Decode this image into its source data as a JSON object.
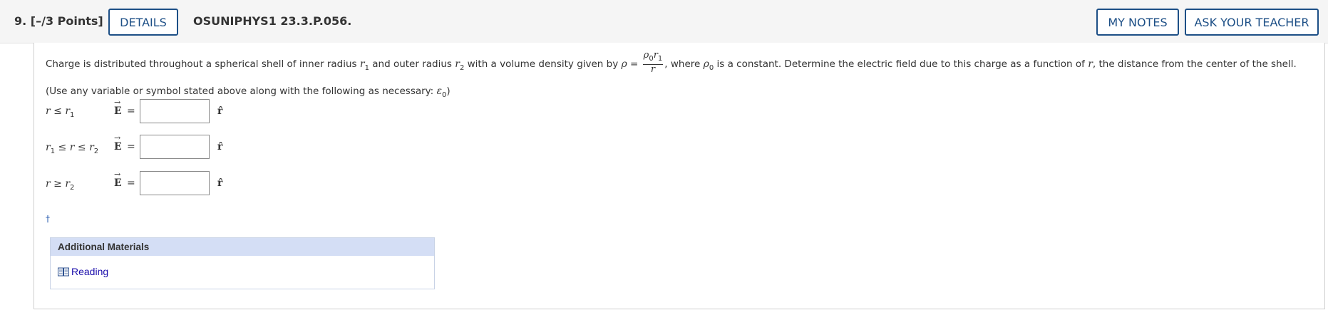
{
  "header": {
    "question_number": "9.",
    "points": "[–/3 Points]",
    "details_label": "DETAILS",
    "question_id": "OSUNIPHYS1 23.3.P.056.",
    "my_notes_label": "MY NOTES",
    "ask_teacher_label": "ASK YOUR TEACHER"
  },
  "prompt": {
    "t1": "Charge is distributed throughout a spherical shell of inner radius ",
    "r": "r",
    "one": "1",
    "two": "2",
    "zero": "0",
    "t2": " and outer radius ",
    "t3": " with a volume density given by ",
    "rho": "ρ",
    "equals": " = ",
    "t4": ", where ",
    "t5": " is a constant. Determine the electric field due to this charge as a function of ",
    "t6": ", the distance from the center of the shell. (Use any variable or symbol stated above along with the following as necessary: ",
    "epsilon": "ε",
    "t7": ")"
  },
  "answers": {
    "rows": [
      {
        "cond_a": "r",
        "op1": " ≤ ",
        "cond_b": "r",
        "cond_b_sub": "1",
        "extra": "",
        "value": ""
      },
      {
        "cond_a": "r",
        "op1": " ≤ ",
        "cond_b": "r",
        "cond_b_sub": "2",
        "extra": "",
        "value": ""
      },
      {
        "cond_a": "r",
        "op1": " ≥ ",
        "cond_b": "r",
        "cond_b_sub": "2",
        "extra": "",
        "value": ""
      }
    ],
    "row2_prefix": "r",
    "row2_prefix_sub": "1",
    "e_symbol": "E",
    "e_arrow": "→",
    "equals": "=",
    "unit_vector": "r̂"
  },
  "dagger": "†",
  "additional_materials": {
    "title": "Additional Materials",
    "link_label": "Reading"
  },
  "colors": {
    "button_border": "#1d4f86",
    "am_header_bg": "#d4def5",
    "link": "#1a0dab"
  }
}
